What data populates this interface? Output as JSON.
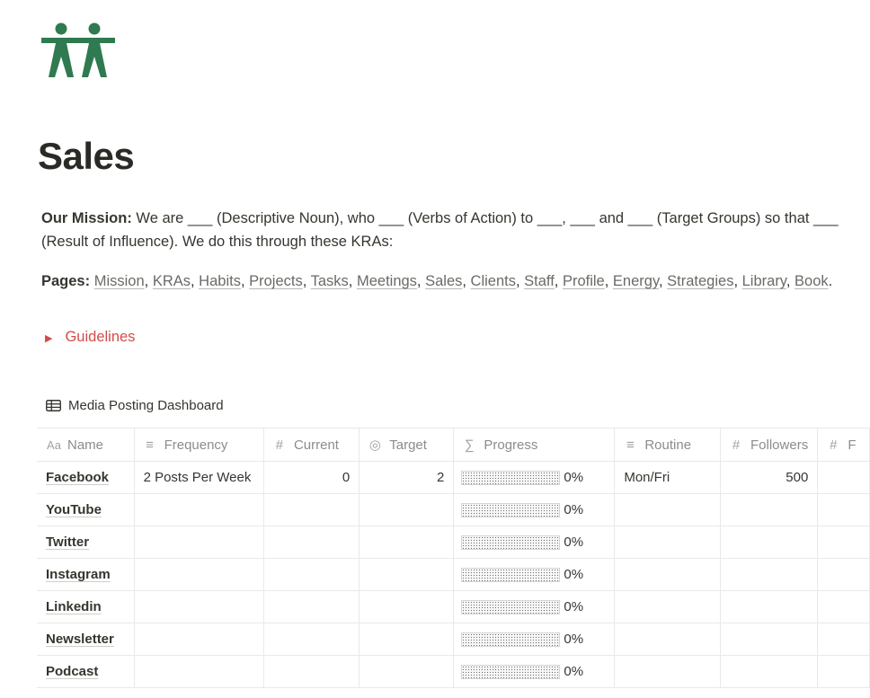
{
  "colors": {
    "logo_green": "#2f7a50",
    "toggle_red": "#d44c47"
  },
  "page": {
    "title": "Sales",
    "mission_label": "Our Mission:",
    "mission_text": " We are ___ (Descriptive Noun), who ___ (Verbs of Action) to ___, ___  and ___  (Target Groups) so that ___ (Result of Influence). We do this through these KRAs:",
    "pages_label": "Pages:",
    "pages_links": [
      "Mission",
      "KRAs",
      "Habits",
      "Projects",
      "Tasks",
      "Meetings",
      "Sales",
      "Clients",
      "Staff",
      "Profile",
      "Energy",
      "Strategies",
      "Library",
      "Book"
    ],
    "guidelines_label": "Guidelines"
  },
  "database": {
    "title": "Media Posting Dashboard",
    "columns": [
      {
        "label": "Name",
        "icon": "Aa",
        "icon_name": "title-icon"
      },
      {
        "label": "Frequency",
        "icon": "≡",
        "icon_name": "text-icon"
      },
      {
        "label": "Current",
        "icon": "#",
        "icon_name": "number-icon"
      },
      {
        "label": "Target",
        "icon": "◎",
        "icon_name": "target-icon"
      },
      {
        "label": "Progress",
        "icon": "∑",
        "icon_name": "formula-icon"
      },
      {
        "label": "Routine",
        "icon": "≡",
        "icon_name": "text-icon"
      },
      {
        "label": "Followers",
        "icon": "#",
        "icon_name": "number-icon"
      },
      {
        "label": "F",
        "icon": "#",
        "icon_name": "number-icon"
      }
    ],
    "rows": [
      {
        "name": "Facebook",
        "frequency": "2 Posts Per Week",
        "current": "0",
        "target": "2",
        "progress": 0,
        "progress_label": "0%",
        "routine": "Mon/Fri",
        "followers": "500"
      },
      {
        "name": "YouTube",
        "frequency": "",
        "current": "",
        "target": "",
        "progress": 0,
        "progress_label": "0%",
        "routine": "",
        "followers": ""
      },
      {
        "name": "Twitter",
        "frequency": "",
        "current": "",
        "target": "",
        "progress": 0,
        "progress_label": "0%",
        "routine": "",
        "followers": ""
      },
      {
        "name": "Instagram",
        "frequency": "",
        "current": "",
        "target": "",
        "progress": 0,
        "progress_label": "0%",
        "routine": "",
        "followers": ""
      },
      {
        "name": "Linkedin",
        "frequency": "",
        "current": "",
        "target": "",
        "progress": 0,
        "progress_label": "0%",
        "routine": "",
        "followers": ""
      },
      {
        "name": "Newsletter",
        "frequency": "",
        "current": "",
        "target": "",
        "progress": 0,
        "progress_label": "0%",
        "routine": "",
        "followers": ""
      },
      {
        "name": "Podcast",
        "frequency": "",
        "current": "",
        "target": "",
        "progress": 0,
        "progress_label": "0%",
        "routine": "",
        "followers": ""
      }
    ]
  }
}
